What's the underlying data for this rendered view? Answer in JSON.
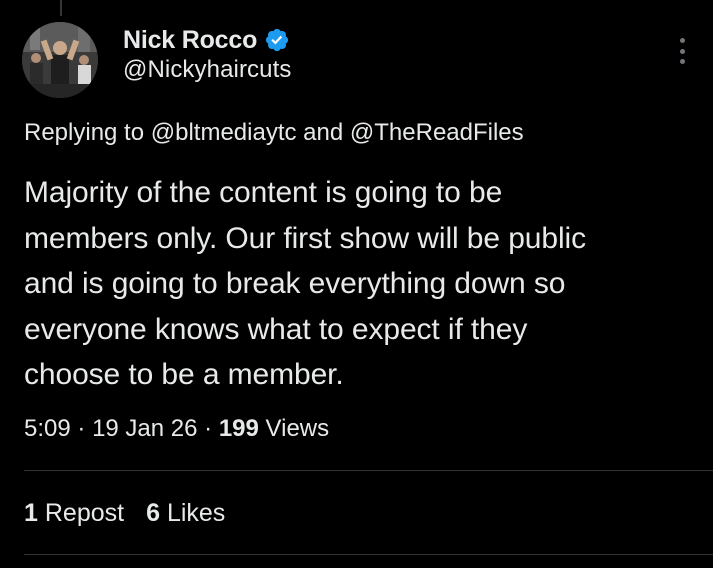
{
  "author": {
    "display_name": "Nick Rocco",
    "handle": "@Nickyhaircuts",
    "verified": true
  },
  "reply": {
    "prefix": "Replying to",
    "mention_1": "@bltmediaytc",
    "joiner": "and",
    "mention_2": "@TheReadFiles"
  },
  "tweet": {
    "lines": [
      "Majority of the content is going to be",
      "members only. Our first show will be public",
      "and is going to break everything down so",
      "everyone knows what to expect if they",
      "choose to be a member."
    ]
  },
  "meta": {
    "time": "5:09",
    "date": "19 Jan 26",
    "views_count": "199",
    "views_label": "Views",
    "separator": "·"
  },
  "stats": {
    "reposts_count": "1",
    "reposts_label": "Repost",
    "likes_count": "6",
    "likes_label": "Likes"
  },
  "icons": {
    "verified": "verified-badge-icon",
    "more": "more-options-icon"
  },
  "colors": {
    "background": "#000000",
    "text": "#e7e9ea",
    "verified_blue": "#1d9bf0",
    "divider": "#2f3336",
    "muted": "#71767b"
  }
}
